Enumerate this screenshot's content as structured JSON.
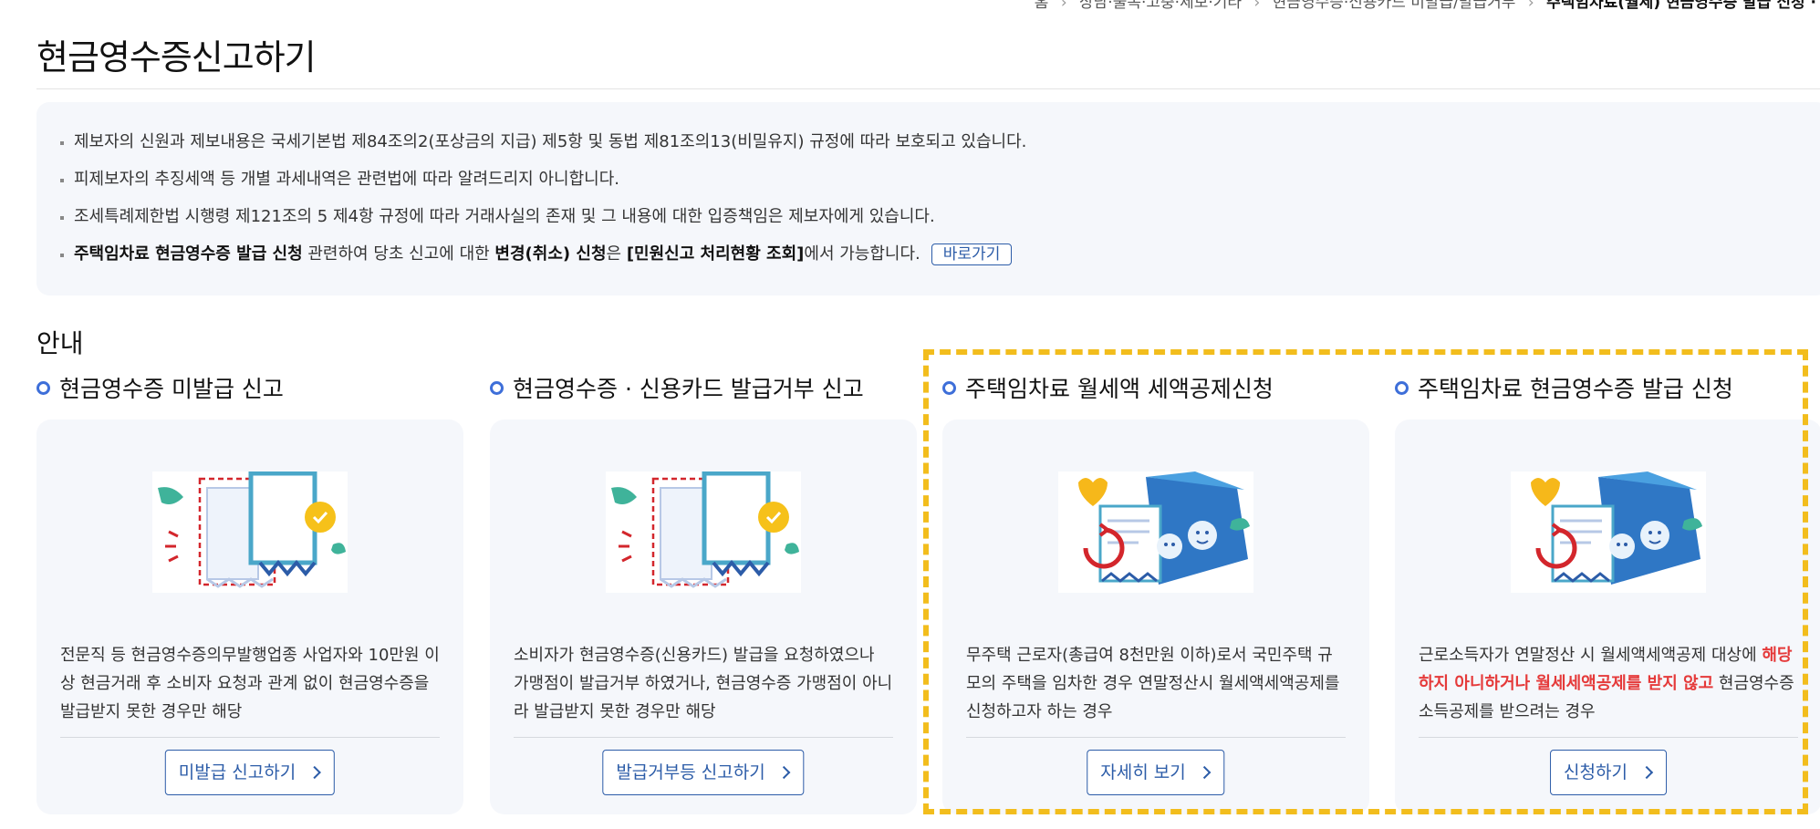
{
  "breadcrumb": {
    "items": [
      "홈",
      "상담·불복·고충·제보·기타",
      "현금영수증·신용카드 미발급/발급거부"
    ],
    "current": "주택임차료(월세) 현금영수증 발급 신청 ·"
  },
  "page_title": "현금영수증신고하기",
  "notices": {
    "item1": "제보자의 신원과 제보내용은 국세기본법 제84조의2(포상금의 지급) 제5항 및 동법 제81조의13(비밀유지) 규정에 따라 보호되고 있습니다.",
    "item2": "피제보자의 추징세액 등 개별 과세내역은 관련법에 따라 알려드리지 아니합니다.",
    "item3": "조세특례제한법 시행령 제121조의 5 제4항 규정에 따라 거래사실의 존재 및 그 내용에 대한 입증책임은 제보자에게 있습니다.",
    "item4": {
      "bold1": "주택임차료 현금영수증 발급 신청",
      "text1": " 관련하여 당초 신고에 대한 ",
      "bold2": "변경(취소) 신청",
      "text2": "은 ",
      "bold3": "[민원신고 처리현황 조회]",
      "text3": "에서 가능합니다.",
      "button": "바로가기"
    }
  },
  "section_title": "안내",
  "cards": [
    {
      "heading": "현금영수증 미발급 신고",
      "icon": "receipt-icon",
      "desc": "전문직 등 현금영수증의무발행업종 사업자와 10만원 이상 현금거래 후 소비자 요청과 관계 없이 현금영수증을 발급받지 못한 경우만 해당",
      "button": "미발급 신고하기"
    },
    {
      "heading": "현금영수증 · 신용카드 발급거부 신고",
      "icon": "receipt-icon",
      "desc": "소비자가 현금영수증(신용카드) 발급을 요청하였으나 가맹점이 발급거부 하였거나, 현금영수증 가맹점이 아니라 발급받지 못한 경우만 해당",
      "button": "발급거부등 신고하기"
    },
    {
      "heading": "주택임차료 월세액 세액공제신청",
      "icon": "house-document-icon",
      "desc": "무주택 근로자(총급여 8천만원 이하)로서 국민주택 규모의 주택을 임차한 경우 연말정산시 월세액세액공제를 신청하고자 하는 경우",
      "button": "자세히 보기"
    },
    {
      "heading": "주택임차료 현금영수증 발급 신청",
      "icon": "house-document-icon",
      "desc_part1": "근로소득자가 연말정산 시 월세액세액공제 대상에 ",
      "desc_highlight": "해당하지 아니하거나 월세세액공제를 받지 않고",
      "desc_part2": " 현금영수증 소득공제를 받으려는 경우",
      "button": "신청하기"
    }
  ],
  "colors": {
    "accent_blue": "#2c5ca8",
    "bullet_ring": "#3e6fd9",
    "highlight_red": "#e53a3a",
    "dashed_highlight": "#f2bd1d",
    "panel_bg": "#f5f7fb"
  }
}
